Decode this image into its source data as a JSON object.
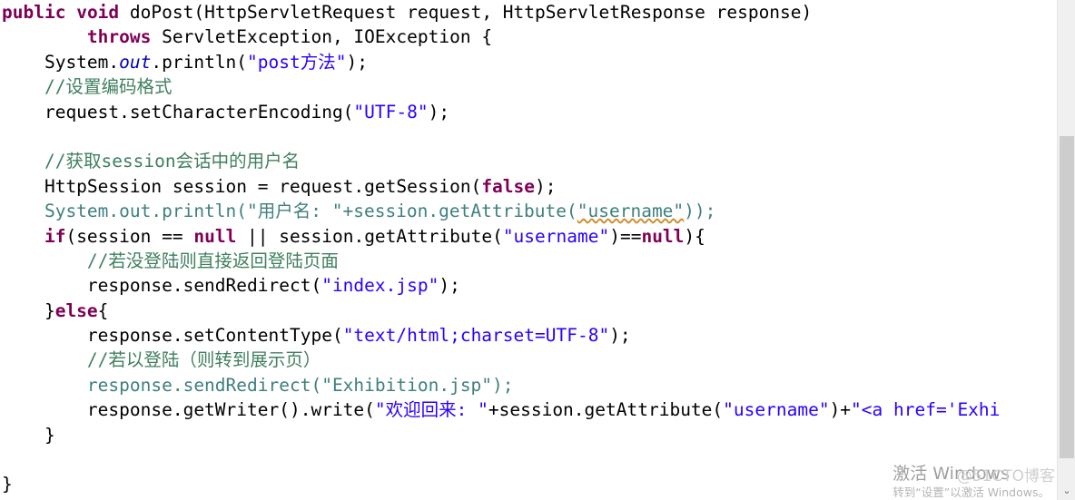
{
  "editor": {
    "language": "java",
    "colors": {
      "keyword": "#7f0055",
      "string": "#2a00ff",
      "comment": "#3f7f5f",
      "plain": "#000000",
      "field": "#0000c0",
      "deemphasised": "#3f7f7f",
      "background": "#ffffff",
      "scrollbar_track": "#f0f0f0",
      "scrollbar_thumb": "#cdcdcd",
      "squiggle": "#d08a2a"
    },
    "lines": [
      {
        "n": 1,
        "text": "public void doPost(HttpServletRequest request, HttpServletResponse response)",
        "tokens": [
          {
            "t": "public",
            "c": "kw"
          },
          {
            "t": " ",
            "c": "plain"
          },
          {
            "t": "void",
            "c": "kw"
          },
          {
            "t": " doPost(HttpServletRequest request, HttpServletResponse response)",
            "c": "plain"
          }
        ]
      },
      {
        "n": 2,
        "text": "        throws ServletException, IOException {",
        "tokens": [
          {
            "t": "        ",
            "c": "plain"
          },
          {
            "t": "throws",
            "c": "kw"
          },
          {
            "t": " ServletException, IOException {",
            "c": "plain"
          }
        ]
      },
      {
        "n": 3,
        "text": "    System.out.println(\"post方法\");",
        "tokens": [
          {
            "t": "    System.",
            "c": "plain"
          },
          {
            "t": "out",
            "c": "field"
          },
          {
            "t": ".println(",
            "c": "plain"
          },
          {
            "t": "\"post方法\"",
            "c": "str"
          },
          {
            "t": ");",
            "c": "plain"
          }
        ]
      },
      {
        "n": 4,
        "text": "    //设置编码格式",
        "tokens": [
          {
            "t": "    ",
            "c": "plain"
          },
          {
            "t": "//设置编码格式",
            "c": "cmt"
          }
        ]
      },
      {
        "n": 5,
        "text": "    request.setCharacterEncoding(\"UTF-8\");",
        "tokens": [
          {
            "t": "    request.setCharacterEncoding(",
            "c": "plain"
          },
          {
            "t": "\"UTF-8\"",
            "c": "str"
          },
          {
            "t": ");",
            "c": "plain"
          }
        ]
      },
      {
        "n": 6,
        "text": "",
        "tokens": []
      },
      {
        "n": 7,
        "text": "    //获取session会话中的用户名",
        "tokens": [
          {
            "t": "    ",
            "c": "plain"
          },
          {
            "t": "//获取session会话中的用户名",
            "c": "cmt"
          }
        ]
      },
      {
        "n": 8,
        "text": "    HttpSession session = request.getSession(false);",
        "tokens": [
          {
            "t": "    HttpSession session = request.getSession(",
            "c": "plain"
          },
          {
            "t": "false",
            "c": "kw"
          },
          {
            "t": ");",
            "c": "plain"
          }
        ]
      },
      {
        "n": 9,
        "text": "    System.out.println(\"用户名: \"+session.getAttribute(\"username\"));",
        "tokens": [
          {
            "t": "    System.out.println(\"用户名: \"+session.getAttribute(",
            "c": "teal"
          },
          {
            "t": "\"username\"",
            "c": "teal squiggle"
          },
          {
            "t": "));",
            "c": "teal"
          }
        ]
      },
      {
        "n": 10,
        "text": "    if(session == null || session.getAttribute(\"username\")==null){",
        "tokens": [
          {
            "t": "    ",
            "c": "plain"
          },
          {
            "t": "if",
            "c": "kw"
          },
          {
            "t": "(session == ",
            "c": "plain"
          },
          {
            "t": "null",
            "c": "kw"
          },
          {
            "t": " || session.getAttribute(",
            "c": "plain"
          },
          {
            "t": "\"username\"",
            "c": "str"
          },
          {
            "t": ")==",
            "c": "plain"
          },
          {
            "t": "null",
            "c": "kw"
          },
          {
            "t": "){",
            "c": "plain"
          }
        ]
      },
      {
        "n": 11,
        "text": "        //若没登陆则直接返回登陆页面",
        "tokens": [
          {
            "t": "        ",
            "c": "plain"
          },
          {
            "t": "//若没登陆则直接返回登陆页面",
            "c": "cmt"
          }
        ]
      },
      {
        "n": 12,
        "text": "        response.sendRedirect(\"index.jsp\");",
        "tokens": [
          {
            "t": "        response.sendRedirect(",
            "c": "plain"
          },
          {
            "t": "\"index.jsp\"",
            "c": "str"
          },
          {
            "t": ");",
            "c": "plain"
          }
        ]
      },
      {
        "n": 13,
        "text": "    }else{",
        "tokens": [
          {
            "t": "    }",
            "c": "plain"
          },
          {
            "t": "else",
            "c": "kw"
          },
          {
            "t": "{",
            "c": "plain"
          }
        ]
      },
      {
        "n": 14,
        "text": "        response.setContentType(\"text/html;charset=UTF-8\");",
        "tokens": [
          {
            "t": "        response.setContentType(",
            "c": "plain"
          },
          {
            "t": "\"text/html;charset=UTF-8\"",
            "c": "str"
          },
          {
            "t": ");",
            "c": "plain"
          }
        ]
      },
      {
        "n": 15,
        "text": "        //若以登陆（则转到展示页）",
        "tokens": [
          {
            "t": "        ",
            "c": "plain"
          },
          {
            "t": "//若以登陆（则转到展示页）",
            "c": "cmt"
          }
        ]
      },
      {
        "n": 16,
        "text": "        response.sendRedirect(\"Exhibition.jsp\");",
        "tokens": [
          {
            "t": "        response.sendRedirect(\"Exhibition.jsp\");",
            "c": "teal"
          }
        ]
      },
      {
        "n": 17,
        "text": "        response.getWriter().write(\"欢迎回来: \"+session.getAttribute(\"username\")+\"<a href='Exhi",
        "tokens": [
          {
            "t": "        response.getWriter().write(",
            "c": "plain"
          },
          {
            "t": "\"欢迎回来: \"",
            "c": "str"
          },
          {
            "t": "+session.getAttribute(",
            "c": "plain"
          },
          {
            "t": "\"username\"",
            "c": "str"
          },
          {
            "t": ")+",
            "c": "plain"
          },
          {
            "t": "\"<a href='Exhi",
            "c": "str"
          }
        ]
      },
      {
        "n": 18,
        "text": "    }",
        "tokens": [
          {
            "t": "    }",
            "c": "plain"
          }
        ]
      },
      {
        "n": 19,
        "text": "",
        "tokens": []
      },
      {
        "n": 20,
        "text": "}",
        "tokens": [
          {
            "t": "}",
            "c": "plain"
          }
        ]
      }
    ]
  },
  "scrollbar": {
    "down_arrow": "⌄"
  },
  "watermark": {
    "title": "激活 Windows",
    "subtitle": "转到“设置”以激活 Windows。",
    "site": "@51CTO博客"
  }
}
